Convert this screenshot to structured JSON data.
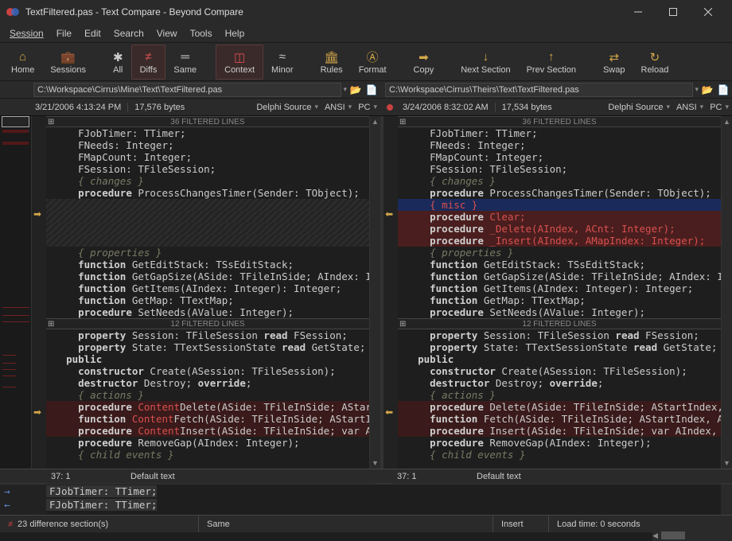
{
  "window": {
    "title": "TextFiltered.pas - Text Compare - Beyond Compare"
  },
  "menu": {
    "session": "Session",
    "file": "File",
    "edit": "Edit",
    "search": "Search",
    "view": "View",
    "tools": "Tools",
    "help": "Help"
  },
  "toolbar": {
    "home": "Home",
    "sessions": "Sessions",
    "all": "All",
    "diffs": "Diffs",
    "same": "Same",
    "context": "Context",
    "minor": "Minor",
    "rules": "Rules",
    "format": "Format",
    "copy": "Copy",
    "next_section": "Next Section",
    "prev_section": "Prev Section",
    "swap": "Swap",
    "reload": "Reload"
  },
  "left": {
    "path": "C:\\Workspace\\Cirrus\\Mine\\Text\\TextFiltered.pas",
    "date": "3/21/2006 4:13:24 PM",
    "size": "17,576 bytes",
    "lang": "Delphi Source",
    "enc": "ANSI",
    "eol": "PC",
    "cursor": "37: 1",
    "style": "Default text",
    "block1": [
      {
        "t": "    FJobTimer: TTimer;"
      },
      {
        "t": "    FNeeds: Integer;"
      },
      {
        "t": "    FMapCount: Integer;"
      },
      {
        "t": "    FSession: TFileSession;"
      },
      {
        "t": "    { changes }",
        "cls": "cmt"
      },
      {
        "t": "    procedure ProcessChangesTimer(Sender: TObject);",
        "kw": "procedure"
      },
      {
        "t": "",
        "cls": "hatched"
      },
      {
        "t": "",
        "cls": "hatched"
      },
      {
        "t": "",
        "cls": "hatched"
      },
      {
        "t": "",
        "cls": "hatched"
      },
      {
        "t": "    { properties }",
        "cls": "cmt"
      },
      {
        "t": "    function GetEditStack: TSsEditStack;",
        "kw": "function"
      },
      {
        "t": "    function GetGapSize(ASide: TFileInSide; AIndex: In",
        "kw": "function"
      },
      {
        "t": "    function GetItems(AIndex: Integer): Integer;",
        "kw": "function"
      },
      {
        "t": "    function GetMap: TTextMap;",
        "kw": "function"
      },
      {
        "t": "    procedure SetNeeds(AValue: Integer);",
        "kw": "procedure"
      }
    ],
    "block2_hdr": "12 FILTERED LINES",
    "block2": [
      {
        "t": "    property Session: TFileSession read FSession;",
        "kw": "property"
      },
      {
        "t": "    property State: TTextSessionState read GetState;",
        "kw": "property"
      },
      {
        "t": "  public",
        "kw": "public"
      },
      {
        "t": "    constructor Create(ASession: TFileSession);",
        "kw": "constructor"
      },
      {
        "t": "    destructor Destroy; override;",
        "kw": "destructor"
      },
      {
        "t": "    { actions }",
        "cls": "cmt"
      },
      {
        "t": "    procedure |Content|Delete(ASide: TFileInSide; AStartIn",
        "kw": "procedure",
        "cls": "red-bg",
        "red": "Content"
      },
      {
        "t": "    function |Content|Fetch(ASide: TFileInSide; AStartIn",
        "kw": "function",
        "cls": "red-bg",
        "red": "Content"
      },
      {
        "t": "    procedure |Content|Insert(ASide: TFileInSide; var AI",
        "kw": "procedure",
        "cls": "red-bg",
        "red": "Content"
      },
      {
        "t": "    procedure RemoveGap(AIndex: Integer);",
        "kw": "procedure"
      },
      {
        "t": "    { child events }",
        "cls": "cmt"
      }
    ]
  },
  "right": {
    "path": "C:\\Workspace\\Cirrus\\Theirs\\Text\\TextFiltered.pas",
    "date": "3/24/2006 8:32:02 AM",
    "size": "17,534 bytes",
    "lang": "Delphi Source",
    "enc": "ANSI",
    "eol": "PC",
    "cursor": "37: 1",
    "style": "Default text",
    "block1": [
      {
        "t": "    FJobTimer: TTimer;"
      },
      {
        "t": "    FNeeds: Integer;"
      },
      {
        "t": "    FMapCount: Integer;"
      },
      {
        "t": "    FSession: TFileSession;"
      },
      {
        "t": "    { changes }",
        "cls": "cmt"
      },
      {
        "t": "    procedure ProcessChangesTimer(Sender: TObject);",
        "kw": "procedure"
      },
      {
        "t": "    { misc }",
        "cls": "blue-bg cmt-red",
        "red": "{ misc }"
      },
      {
        "t": "    procedure Clear;",
        "cls": "red-bg2",
        "kw_red": "procedure",
        "red": "Clear;"
      },
      {
        "t": "    procedure _Delete(AIndex, ACnt: Integer);",
        "cls": "red-bg2",
        "kw_red": "procedure",
        "red": "_Delete(AIndex, ACnt: Integer);"
      },
      {
        "t": "    procedure _Insert(AIndex, AMapIndex: Integer);",
        "cls": "red-bg2",
        "kw_red": "procedure",
        "red": "_Insert(AIndex, AMapIndex: Integer);"
      },
      {
        "t": "    { properties }",
        "cls": "cmt"
      },
      {
        "t": "    function GetEditStack: TSsEditStack;",
        "kw": "function"
      },
      {
        "t": "    function GetGapSize(ASide: TFileInSide; AIndex: In",
        "kw": "function"
      },
      {
        "t": "    function GetItems(AIndex: Integer): Integer;",
        "kw": "function"
      },
      {
        "t": "    function GetMap: TTextMap;",
        "kw": "function"
      },
      {
        "t": "    procedure SetNeeds(AValue: Integer);",
        "kw": "procedure"
      }
    ],
    "block2_hdr": "12 FILTERED LINES",
    "block2": [
      {
        "t": "    property Session: TFileSession read FSession;",
        "kw": "property"
      },
      {
        "t": "    property State: TTextSessionState read GetState;",
        "kw": "property"
      },
      {
        "t": "  public",
        "kw": "public"
      },
      {
        "t": "    constructor Create(ASession: TFileSession);",
        "kw": "constructor"
      },
      {
        "t": "    destructor Destroy; override;",
        "kw": "destructor"
      },
      {
        "t": "    { actions }",
        "cls": "cmt"
      },
      {
        "t": "    procedure Delete(ASide: TFileInSide; AStartIndex,",
        "kw": "procedure",
        "cls": "red-bg"
      },
      {
        "t": "    function Fetch(ASide: TFileInSide; AStartIndex, AS",
        "kw": "function",
        "cls": "red-bg"
      },
      {
        "t": "    procedure Insert(ASide: TFileInSide; var AIndex, A",
        "kw": "procedure",
        "cls": "red-bg"
      },
      {
        "t": "    procedure RemoveGap(AIndex: Integer);",
        "kw": "procedure"
      },
      {
        "t": "    { child events }",
        "cls": "cmt"
      }
    ]
  },
  "filtered_hdr": "36 FILTERED LINES",
  "bottom": {
    "line1": "FJobTimer: TTimer;",
    "line2": "FJobTimer: TTimer;"
  },
  "status": {
    "diffs": "23 difference section(s)",
    "mode": "Same",
    "insert": "Insert",
    "load": "Load time: 0 seconds"
  }
}
